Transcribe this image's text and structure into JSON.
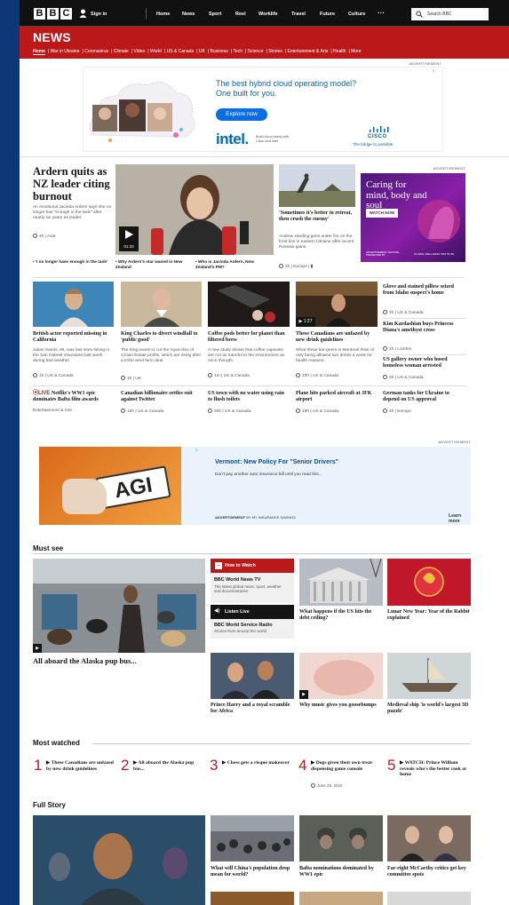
{
  "header": {
    "brand_letters": [
      "B",
      "B",
      "C"
    ],
    "sign_in": "Sign in",
    "nav": [
      "Home",
      "News",
      "Sport",
      "Reel",
      "Worklife",
      "Travel",
      "Future",
      "Culture"
    ],
    "more": "···",
    "search_placeholder": "Search BBC"
  },
  "news_bar": {
    "title": "NEWS",
    "subnav": [
      "Home",
      "War in Ukraine",
      "Coronavirus",
      "Climate",
      "Video",
      "World",
      "US & Canada",
      "UK",
      "Business",
      "Tech",
      "Science",
      "Stories",
      "Entertainment & Arts",
      "Health",
      "More"
    ]
  },
  "ad_intel": {
    "label": "ADVERTISEMENT",
    "headline": "The best hybrid cloud operating model? One built for you.",
    "cta": "Explore now",
    "intel": "intel.",
    "intel_sub": "Build cloud-ready with Cisco and Intel",
    "cisco": "CISCO",
    "cisco_sub": "The bridge to possible"
  },
  "lead": {
    "headline": "Ardern quits as NZ leader citing burnout",
    "summary": "An emotional Jacinda Ardern says she no longer has \"enough in the tank\" after nearly six years as leader.",
    "time": "4h",
    "tag": "Asia",
    "video_time": "01:33",
    "related": [
      "'I no longer have enough in the tank'",
      "Why Ardern's star waned in New Zealand",
      "Who is Jacinda Ardern, New Zealand's PM?"
    ]
  },
  "ukraine": {
    "headline": "'Sometimes it's better to retreat, then crush the enemy'",
    "summary": "Andrew Harding goes under fire on the front line in eastern Ukraine after recent Russian gains.",
    "time": "2h",
    "tag": "Europe"
  },
  "ad_wellcome": {
    "label": "ADVERTISEMENT",
    "headline": "Caring for mind, body and soul",
    "cta": "WATCH NOW",
    "footer": "ADVERTISEMENT FEATURE PRESENTED BY",
    "sponsor": "GLOBAL WELLNESS INSTITUTE"
  },
  "row2": [
    {
      "headline": "British actor reported missing in California",
      "summary": "Julian Sands, 65, was last seen hiking in the San Gabriel mountains last week during bad weather.",
      "time": "1h",
      "tag": "US & Canada"
    },
    {
      "headline": "King Charles to divert windfall to 'public good'",
      "summary": "The King wants to cut the royal slice of Crown Estate profits, which are rising after a £1bn wind farm deal.",
      "time": "1h",
      "tag": "UK"
    },
    {
      "headline": "Coffee pods better for planet than filtered brew",
      "summary": "A new study shows that coffee capsules are not as harmful to the environment as once thought.",
      "time": "1m",
      "tag": "US & Canada"
    },
    {
      "headline": "These Canadians are unfazed by new drink guidelines",
      "summary": "What these bar-goers in Montreal think of only being allowed two drinks a week for health reasons.",
      "time": "23h",
      "tag": "US & Canada",
      "video_time": "1:27"
    }
  ],
  "side_list": [
    {
      "headline": "Glove and stained pillow seized from Idaho suspect's home",
      "time": "2h",
      "tag": "US & Canada"
    },
    {
      "headline": "Kim Kardashian buys Princess Diana's amethyst cross",
      "time": "1h",
      "tag": "London"
    },
    {
      "headline": "US gallery owner who hosed homeless woman arrested",
      "time": "5h",
      "tag": "US & Canada"
    }
  ],
  "row3": [
    {
      "live": "LIVE",
      "headline": "Netflix's WW1 epic dominates Bafta film awards",
      "tag": "Entertainment & Arts"
    },
    {
      "headline": "Canadian billionaire settles suit against Twitter",
      "time": "15h",
      "tag": "US & Canada"
    },
    {
      "headline": "US town with no water using rain to flush toilets",
      "time": "20h",
      "tag": "US & Canada"
    },
    {
      "headline": "Plane hits parked aircraft at JFK airport",
      "time": "19h",
      "tag": "US & Canada"
    },
    {
      "headline": "German tanks for Ukraine to depend on US approval",
      "time": "4h",
      "tag": "Europe"
    }
  ],
  "ad_insurance": {
    "label": "ADVERTISEMENT",
    "plate": "AGI",
    "headline": "Vermont: New Policy For \"Senior Drivers\"",
    "summary": "Don't pay another auto insurance bill until you read this...",
    "footer_bold": "ADVERTISEMENT",
    "footer": "BY MY INSURANCE SAVINGS",
    "cta": "Learn more"
  },
  "must_see": {
    "title": "Must see",
    "main_caption": "All aboard the Alaska pup bus...",
    "how_to_watch": "How to Watch",
    "tv_title": "BBC World News TV",
    "tv_desc": "The latest global news, sport, weather and documentaries",
    "listen_live": "Listen Live",
    "radio_title": "BBC World Service Radio",
    "radio_desc": "Stories from around the world",
    "items": [
      "What happens if the US hits the debt ceiling?",
      "Lunar New Year: Year of the Rabbit explained",
      "Prince Harry and a royal scramble for Africa",
      "Why music gives you goosebumps",
      "Medieval ship 'is world's largest 3D puzzle'"
    ]
  },
  "most_watched": {
    "title": "Most watched",
    "items": [
      {
        "num": "1",
        "text": "These Canadians are unfazed by new drink guidelines"
      },
      {
        "num": "2",
        "text": "All aboard the Alaska pup bus..."
      },
      {
        "num": "3",
        "text": "Chess gets a risqué makeover"
      },
      {
        "num": "4",
        "text": "Dogs given their own treat-dispensing game console",
        "date": "June 29, 2022"
      },
      {
        "num": "5",
        "text": "WATCH: Prince William reveals who's the better cook at home"
      }
    ]
  },
  "full_story": {
    "title": "Full Story",
    "items": [
      "What will China's population drop mean for world?",
      "Bafta nominations dominated by WW1 epic",
      "Far-right McCarthy critics get key committee spots"
    ]
  },
  "colors": {
    "brand_red": "#bb1919",
    "page_blue": "#0e3778",
    "bbc_black": "#111111"
  }
}
